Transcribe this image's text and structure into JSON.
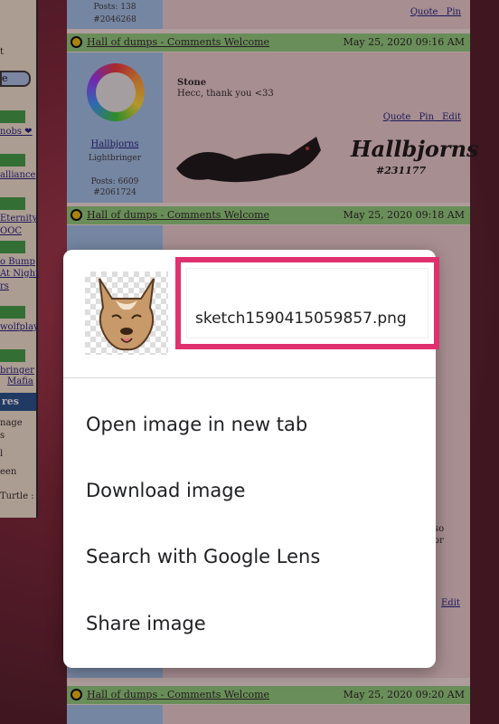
{
  "forum": {
    "prev_post": {
      "posts": "Posts: 138",
      "id": "#2046268",
      "actions": "Quote Pin"
    },
    "post1": {
      "thread": "Hall of dumps - Comments Welcome",
      "date": "May 25, 2020 09:16 AM",
      "author": "Hallbjorns",
      "rank": "Lightbringer",
      "posts": "Posts: 6609",
      "id": "#2061724",
      "title": "Stone",
      "text": "Hecc, thank you <33",
      "actions": "Quote Pin Edit",
      "signature_name": "Hallbjorns",
      "signature_id": "#231177"
    },
    "post2": {
      "thread": "Hall of dumps - Comments Welcome",
      "date": "May 25, 2020 09:18 AM"
    },
    "post3": {
      "thread": "Hall of dumps - Comments Welcome",
      "date": "May 25, 2020 09:20 AM"
    },
    "sidebar": {
      "fragments": [
        "t",
        "e",
        "nobs ❤",
        "alliance",
        "Eternity",
        "OOC",
        "o Bump",
        "At Night",
        "rs",
        "wolfplay",
        "bringer",
        "Mafia",
        "res",
        "nage",
        "s",
        "l",
        "een",
        "Turtle :"
      ]
    },
    "stray_text": [
      "so",
      "or",
      "Edit"
    ]
  },
  "context_menu": {
    "filename": "sketch1590415059857.png",
    "items": [
      "Open image in new tab",
      "Download image",
      "Search with Google Lens",
      "Share image"
    ]
  }
}
